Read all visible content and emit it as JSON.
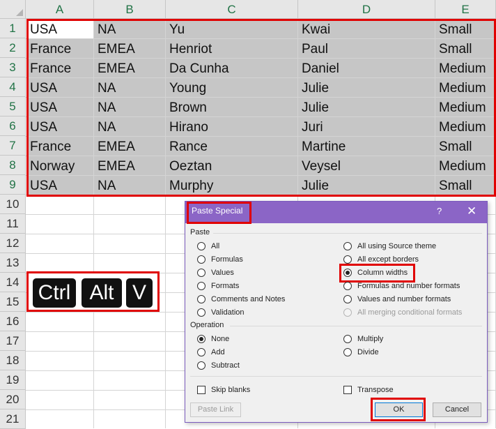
{
  "sheet": {
    "columns": [
      "A",
      "B",
      "C",
      "D",
      "E"
    ],
    "rows": [
      "1",
      "2",
      "3",
      "4",
      "5",
      "6",
      "7",
      "8",
      "9",
      "10",
      "11",
      "12",
      "13",
      "14",
      "15",
      "16",
      "17",
      "18",
      "19",
      "20",
      "21"
    ],
    "data": [
      [
        "USA",
        "NA",
        "Yu",
        "Kwai",
        "Small"
      ],
      [
        "France",
        "EMEA",
        "Henriot",
        "Paul",
        "Small"
      ],
      [
        "France",
        "EMEA",
        "Da Cunha",
        "Daniel",
        "Medium"
      ],
      [
        "USA",
        "NA",
        "Young",
        "Julie",
        "Medium"
      ],
      [
        "USA",
        "NA",
        "Brown",
        "Julie",
        "Medium"
      ],
      [
        "USA",
        "NA",
        "Hirano",
        "Juri",
        "Medium"
      ],
      [
        "France",
        "EMEA",
        "Rance",
        "Martine",
        "Small"
      ],
      [
        "Norway",
        "EMEA",
        "Oeztan",
        "Veysel",
        "Medium"
      ],
      [
        "USA",
        "NA",
        "Murphy",
        "Julie",
        "Small"
      ]
    ]
  },
  "shortcut": {
    "keys": [
      "Ctrl",
      "Alt",
      "V"
    ]
  },
  "dialog": {
    "title": "Paste Special",
    "help": "?",
    "close": "✕",
    "paste_label": "Paste",
    "paste_left": [
      {
        "label": "All",
        "selected": false
      },
      {
        "label": "Formulas",
        "selected": false
      },
      {
        "label": "Values",
        "selected": false
      },
      {
        "label": "Formats",
        "selected": false
      },
      {
        "label": "Comments and Notes",
        "selected": false
      },
      {
        "label": "Validation",
        "selected": false
      }
    ],
    "paste_right": [
      {
        "label": "All using Source theme",
        "selected": false
      },
      {
        "label": "All except borders",
        "selected": false
      },
      {
        "label": "Column widths",
        "selected": true
      },
      {
        "label": "Formulas and number formats",
        "selected": false
      },
      {
        "label": "Values and number formats",
        "selected": false
      },
      {
        "label": "All merging conditional formats",
        "selected": false,
        "disabled": true
      }
    ],
    "operation_label": "Operation",
    "operation_left": [
      {
        "label": "None",
        "selected": true
      },
      {
        "label": "Add",
        "selected": false
      },
      {
        "label": "Subtract",
        "selected": false
      }
    ],
    "operation_right": [
      {
        "label": "Multiply",
        "selected": false
      },
      {
        "label": "Divide",
        "selected": false
      }
    ],
    "skip_blanks": "Skip blanks",
    "transpose": "Transpose",
    "paste_link": "Paste Link",
    "ok": "OK",
    "cancel": "Cancel"
  },
  "colors": {
    "accent": "#8b65c6",
    "highlight": "#e00000",
    "header_text": "#217346"
  }
}
